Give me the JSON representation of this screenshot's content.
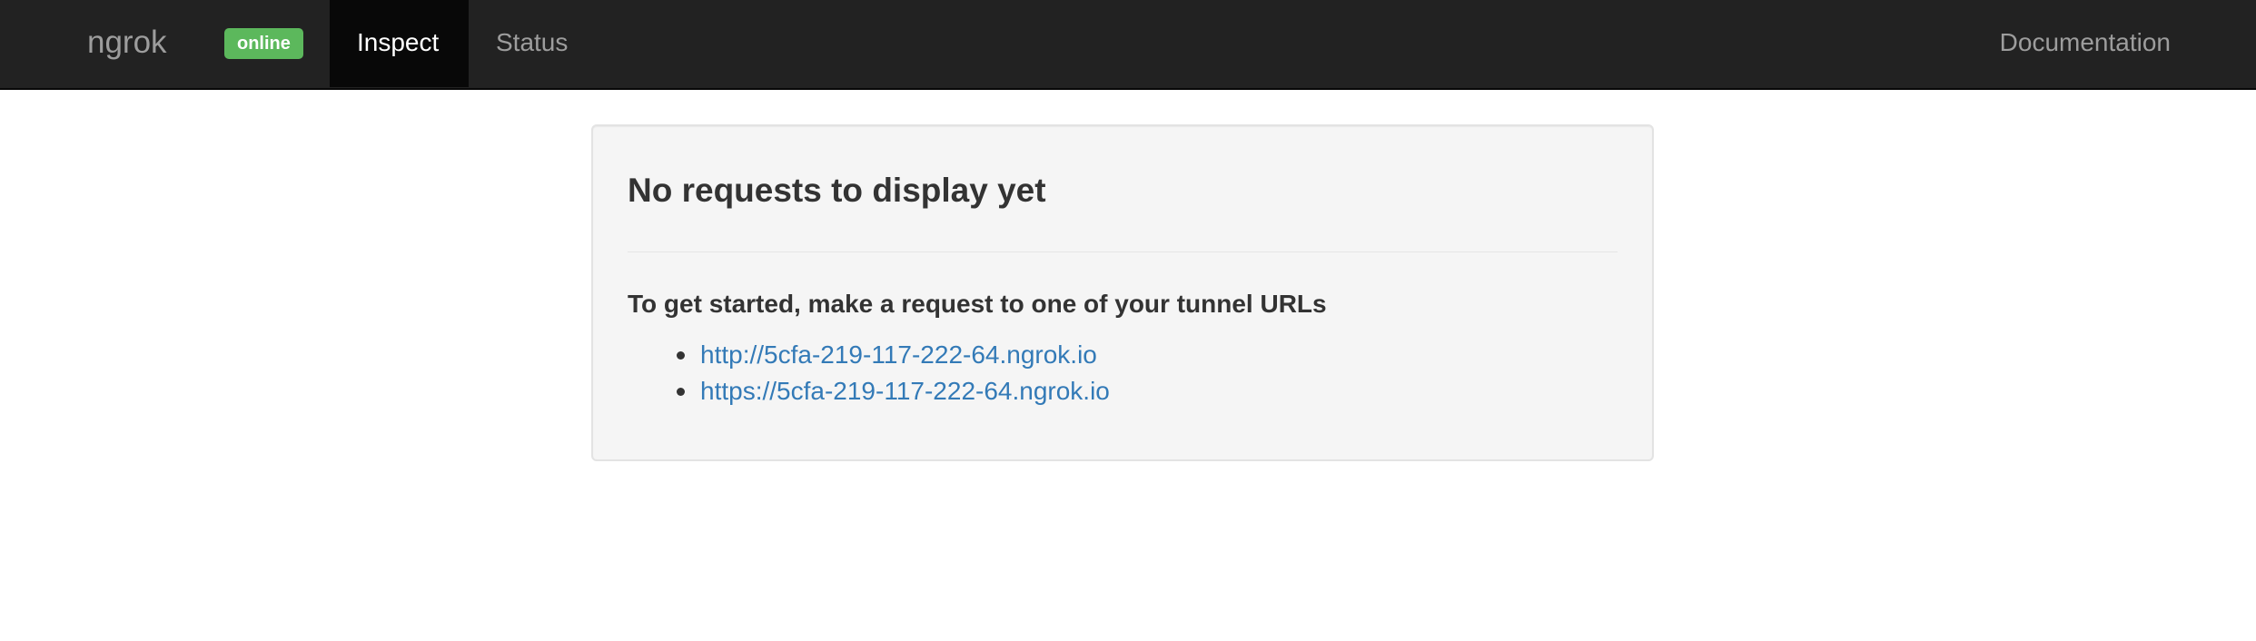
{
  "navbar": {
    "brand": "ngrok",
    "status_badge": "online",
    "tabs": [
      {
        "label": "Inspect",
        "active": true
      },
      {
        "label": "Status",
        "active": false
      }
    ],
    "right_link": "Documentation"
  },
  "main": {
    "title": "No requests to display yet",
    "intro": "To get started, make a request to one of your tunnel URLs",
    "tunnel_urls": [
      "http://5cfa-219-117-222-64.ngrok.io",
      "https://5cfa-219-117-222-64.ngrok.io"
    ]
  },
  "colors": {
    "navbar_bg": "#222222",
    "active_tab_bg": "#080808",
    "badge_green": "#5cb85c",
    "link_blue": "#337ab7",
    "panel_bg": "#f5f5f5"
  }
}
